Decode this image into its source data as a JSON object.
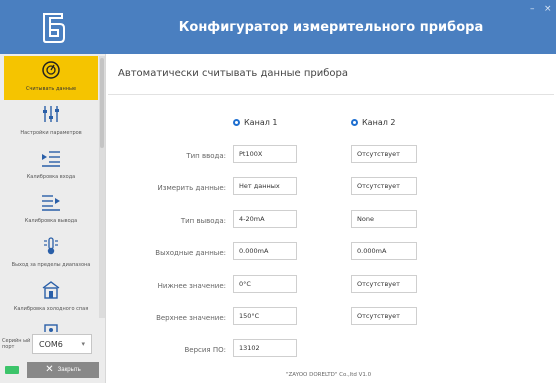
{
  "window": {
    "title": "Конфигуратор измерительного прибора",
    "minimize_glyph": "–",
    "close_glyph": "×"
  },
  "sidebar": {
    "logo_icon": "company-logo",
    "items": [
      {
        "label": "Считывать данные",
        "icon": "gauge-icon",
        "active": true
      },
      {
        "label": "Настройки параметров",
        "icon": "sliders-icon",
        "active": false
      },
      {
        "label": "Калибровка входа",
        "icon": "input-calibration-icon",
        "active": false
      },
      {
        "label": "Калибровка вывода",
        "icon": "output-calibration-icon",
        "active": false
      },
      {
        "label": "Выход за пределы диапазона",
        "icon": "thermometer-icon",
        "active": false
      },
      {
        "label": "Калибровка холодного спая",
        "icon": "building-icon",
        "active": false
      },
      {
        "label": "",
        "icon": "device-icon",
        "active": false
      }
    ],
    "port": {
      "label": "Серийн ый порт",
      "value": "COM6"
    },
    "close_button": {
      "label": "Закрыть",
      "icon": "close-icon"
    },
    "status_color": "#3cc46a"
  },
  "main": {
    "subtitle": "Автоматически считывать данные прибора",
    "channels": [
      "Канал 1",
      "Канал 2"
    ],
    "rows": [
      {
        "label": "Тип ввода:",
        "ch1": "Pt100X",
        "ch2": "Отсутствует"
      },
      {
        "label": "Измерить данные:",
        "ch1": "Нет данных",
        "ch2": "Отсутствует"
      },
      {
        "label": "Тип вывода:",
        "ch1": "4-20mA",
        "ch2": "None"
      },
      {
        "label": "Выходные данные:",
        "ch1": "0.000mA",
        "ch2": "0.000mA"
      },
      {
        "label": "Нижнее значение:",
        "ch1": "0°C",
        "ch2": "Отсутствует"
      },
      {
        "label": "Верхнее значение:",
        "ch1": "150°C",
        "ch2": "Отсутствует"
      }
    ],
    "version_label": "Версия ПО:",
    "version_value": "13102",
    "footer": "\"ZAYOO DORELTD\" Co.,ltd V1.0"
  },
  "colors": {
    "titlebar": "#4a7fc0",
    "active_nav": "#f5c400",
    "radio": "#1e6fd0"
  }
}
